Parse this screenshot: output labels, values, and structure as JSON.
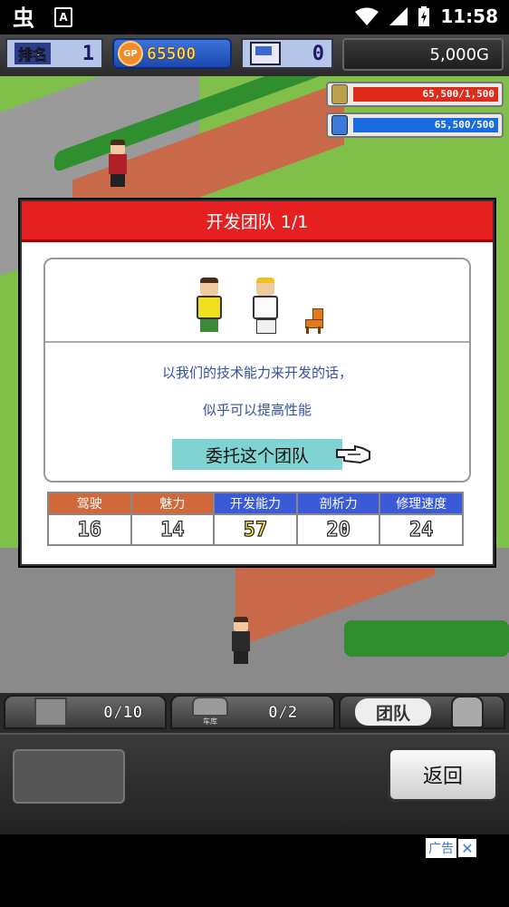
{
  "status_bar": {
    "time": "11:58",
    "notification_icons": [
      "bug-icon",
      "a-icon"
    ],
    "system_icons": [
      "wifi-icon",
      "signal-icon",
      "battery-icon"
    ]
  },
  "hud": {
    "rank_label": "排名",
    "rank_value": "1",
    "gp_coin": "GP",
    "gp_value": "65500",
    "pc_value": "0",
    "money": "5,000G"
  },
  "resources": [
    {
      "icon": "coin-stack-icon",
      "text": "65,500/1,500",
      "fill": 1.0,
      "color": "#e02a1a"
    },
    {
      "icon": "bottle-icon",
      "text": "65,500/500",
      "fill": 1.0,
      "color": "#1a6ae0"
    }
  ],
  "dialog": {
    "title": "开发团队 1/1",
    "line1": "以我们的技术能力来开发的话，",
    "line2": "似乎可以提高性能",
    "entrust_button": "委托这个团队",
    "stats": [
      {
        "label": "驾驶",
        "value": "16",
        "header_color": "#d0683a",
        "value_color": "#ffffff"
      },
      {
        "label": "魅力",
        "value": "14",
        "header_color": "#d0683a",
        "value_color": "#ffffff"
      },
      {
        "label": "开发能力",
        "value": "57",
        "header_color": "#3a5ad8",
        "value_color": "#ffe040"
      },
      {
        "label": "剖析力",
        "value": "20",
        "header_color": "#3a5ad8",
        "value_color": "#ffffff"
      },
      {
        "label": "修理速度",
        "value": "24",
        "header_color": "#3a5ad8",
        "value_color": "#ffffff"
      }
    ]
  },
  "bottom_tabs": {
    "parts_count": "0/10",
    "garage_label": "车库",
    "garage_count": "0/2",
    "team_label": "团队"
  },
  "bottom_panel": {
    "back_button": "返回"
  },
  "ad": {
    "label": "广告",
    "close": "✕"
  }
}
